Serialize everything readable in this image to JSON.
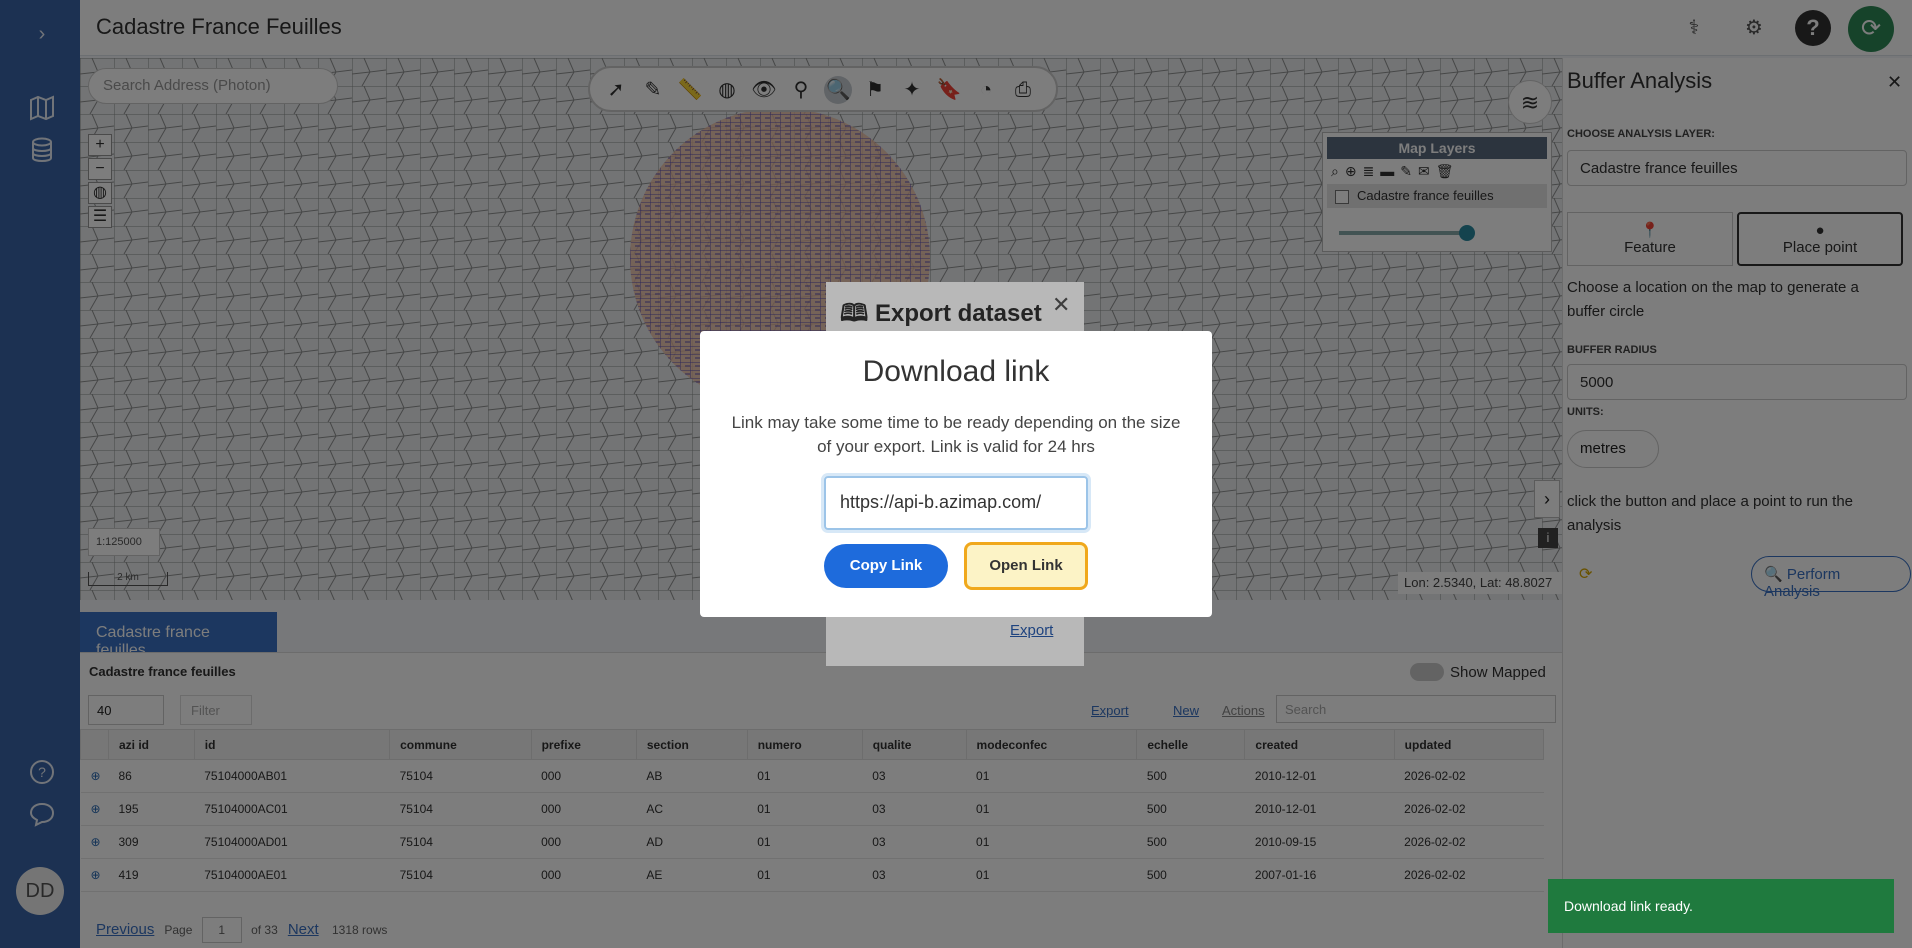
{
  "app": {
    "title": "Cadastre France Feuilles",
    "user_initials": "DD"
  },
  "map": {
    "search_placeholder": "Search Address (Photon)",
    "scale": "1:125000",
    "scalebar": "2 km",
    "coords": "Lon: 2.5340, Lat: 48.8027",
    "layers_panel": {
      "title": "Map Layers",
      "layer_name": "Cadastre france feuilles"
    }
  },
  "data_panel": {
    "tab_label": "Cadastre france feuilles",
    "title": "Cadastre france feuilles",
    "show_mapped": "Show Mapped",
    "page_size": "40",
    "filter_label": "Filter",
    "export_label": "Export",
    "new_label": "New",
    "actions_label": "Actions",
    "search_placeholder": "Search",
    "columns": [
      "azi id",
      "id",
      "commune",
      "prefixe",
      "section",
      "numero",
      "qualite",
      "modeconfec",
      "echelle",
      "created",
      "updated"
    ],
    "rows": [
      [
        "86",
        "75104000AB01",
        "75104",
        "000",
        "AB",
        "01",
        "03",
        "01",
        "500",
        "2010-12-01",
        "2026-02-02"
      ],
      [
        "195",
        "75104000AC01",
        "75104",
        "000",
        "AC",
        "01",
        "03",
        "01",
        "500",
        "2010-12-01",
        "2026-02-02"
      ],
      [
        "309",
        "75104000AD01",
        "75104",
        "000",
        "AD",
        "01",
        "03",
        "01",
        "500",
        "2010-09-15",
        "2026-02-02"
      ],
      [
        "419",
        "75104000AE01",
        "75104",
        "000",
        "AE",
        "01",
        "03",
        "01",
        "500",
        "2007-01-16",
        "2026-02-02"
      ]
    ],
    "pager": {
      "previous": "Previous",
      "page_label": "Page",
      "page": "1",
      "of": "of 33",
      "next": "Next",
      "rows": "1318 rows"
    }
  },
  "sidebar": {
    "title": "Buffer Analysis",
    "choose_layer_label": "CHOOSE ANALYSIS LAYER:",
    "layer_value": "Cadastre france feuilles",
    "mode_feature": "Feature",
    "mode_place": "Place point",
    "instruction": "Choose a location on the map to generate a buffer circle",
    "radius_label": "BUFFER RADIUS",
    "radius_value": "5000",
    "units_label": "UNITS:",
    "units_value": "metres",
    "run_hint": "click the button and place a point to run the analysis",
    "perform_label": "Perform Analysis"
  },
  "export_dialog": {
    "title": "Export dataset",
    "export_link": "Export"
  },
  "download_modal": {
    "title": "Download link",
    "text": "Link may take some time to be ready depending on the size of your export. Link is valid for 24 hrs",
    "url": "https://api-b.azimap.com/",
    "copy_label": "Copy Link",
    "open_label": "Open Link"
  },
  "toast": {
    "message": "Download link ready."
  }
}
